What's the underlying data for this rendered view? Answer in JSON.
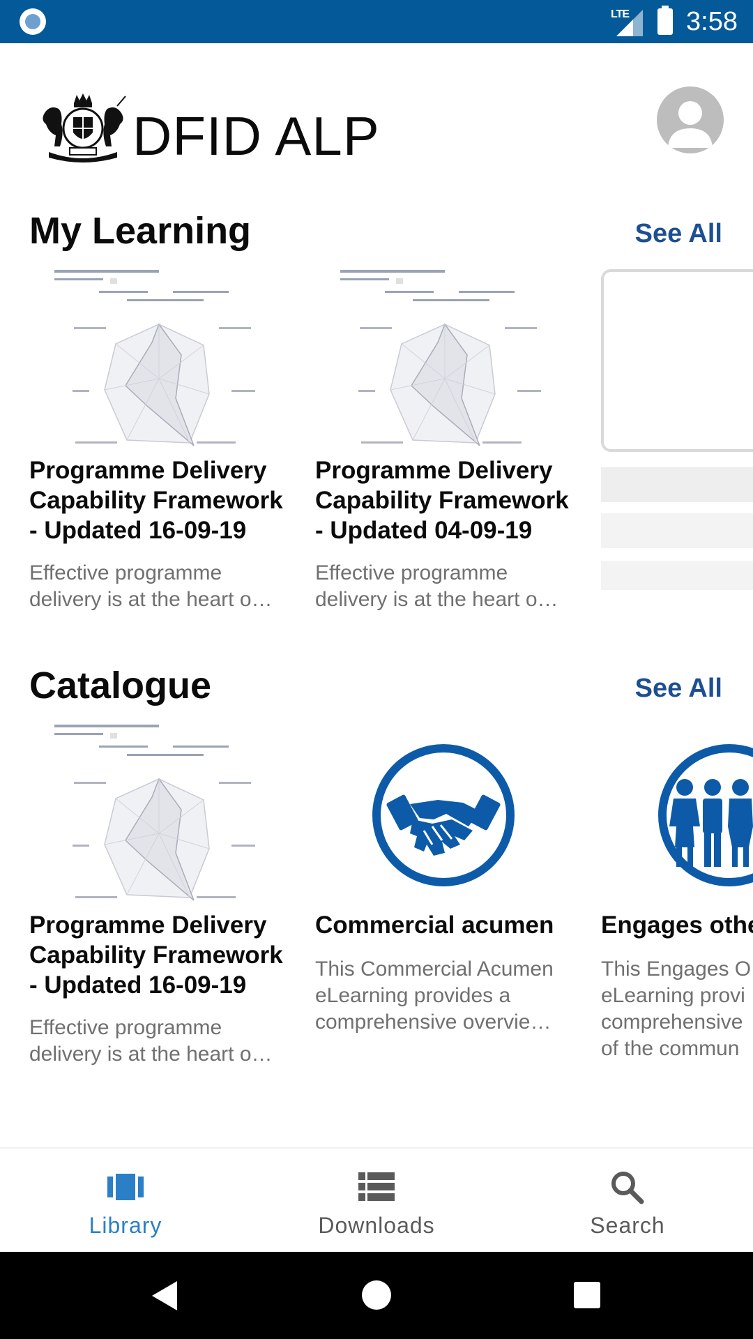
{
  "status_bar": {
    "network": "LTE",
    "time": "3:58"
  },
  "header": {
    "title": "DFID ALP",
    "logo": "uk-royal-coat-of-arms",
    "avatar_icon": "user-avatar-icon"
  },
  "my_learning": {
    "title": "My Learning",
    "see_all": "See All",
    "items": [
      {
        "title": "Programme Delivery Capability Framework - Updated 16-09-19",
        "description": "Effective programme delivery is at the heart o…",
        "image": "radar-chart-thumbnail"
      },
      {
        "title": "Programme Delivery Capability Framework - Updated 04-09-19",
        "description": "Effective programme delivery is at the heart o…",
        "image": "radar-chart-thumbnail"
      }
    ]
  },
  "catalogue": {
    "title": "Catalogue",
    "see_all": "See All",
    "items": [
      {
        "title": "Programme Delivery Capability Framework - Updated 16-09-19",
        "description": "Effective programme delivery is at the heart o…",
        "image": "radar-chart-thumbnail"
      },
      {
        "title": "Commercial acumen",
        "description": "This Commercial Acumen eLearning provides a comprehensive overvie…",
        "image": "handshake-icon"
      },
      {
        "title": "Engages othe",
        "description": "This Engages O eLearning provi comprehensive of the commun",
        "image": "people-group-icon"
      }
    ]
  },
  "bottom_nav": {
    "items": [
      {
        "label": "Library",
        "icon": "library-icon",
        "active": true
      },
      {
        "label": "Downloads",
        "icon": "downloads-icon",
        "active": false
      },
      {
        "label": "Search",
        "icon": "search-icon",
        "active": false
      }
    ]
  },
  "colors": {
    "status_bar": "#045a98",
    "accent": "#1d4f91",
    "nav_active": "#2a7fc7",
    "icon_blue": "#0d5ba8"
  }
}
